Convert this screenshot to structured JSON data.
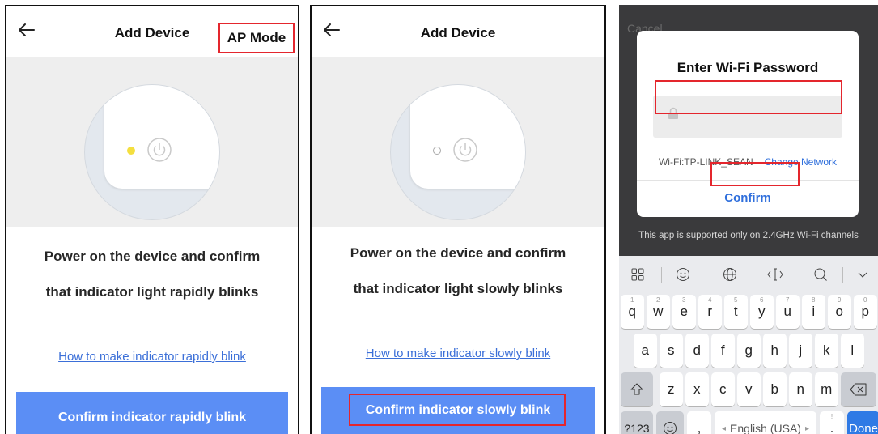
{
  "panel1": {
    "title": "Add Device",
    "ap_mode": "AP Mode",
    "instruction_line1": "Power on the device and confirm",
    "instruction_line2": "that indicator light rapidly blinks",
    "help_link": "How to make indicator rapidly blink",
    "confirm_button": "Confirm indicator rapidly blink"
  },
  "panel2": {
    "title": "Add Device",
    "instruction_line1": "Power on the device and confirm",
    "instruction_line2": "that indicator light slowly blinks",
    "help_link": "How to make indicator slowly blink",
    "confirm_button": "Confirm indicator slowly blink"
  },
  "panel3": {
    "cancel": "Cancel",
    "dialog_title": "Enter Wi-Fi Password",
    "wifi_label": "Wi-Fi:TP-LINK_SEAN",
    "change_network": "Change Network",
    "confirm": "Confirm",
    "note": "This app is supported only on 2.4GHz Wi-Fi channels",
    "keyboard": {
      "row1": [
        {
          "k": "q",
          "n": "1"
        },
        {
          "k": "w",
          "n": "2"
        },
        {
          "k": "e",
          "n": "3"
        },
        {
          "k": "r",
          "n": "4"
        },
        {
          "k": "t",
          "n": "5"
        },
        {
          "k": "y",
          "n": "6"
        },
        {
          "k": "u",
          "n": "7"
        },
        {
          "k": "i",
          "n": "8"
        },
        {
          "k": "o",
          "n": "9"
        },
        {
          "k": "p",
          "n": "0"
        }
      ],
      "row2": [
        "a",
        "s",
        "d",
        "f",
        "g",
        "h",
        "j",
        "k",
        "l"
      ],
      "row3": [
        "z",
        "x",
        "c",
        "v",
        "b",
        "n",
        "m"
      ],
      "mode_key": "?123",
      "comma_key": ",",
      "space_label": "English (USA)",
      "period_key": ".",
      "period_sup": "!",
      "done_key": "Done"
    }
  },
  "colors": {
    "accent_blue": "#5b8ef5",
    "link_blue": "#3b6fd8",
    "highlight_red": "#e4262d",
    "indicator_yellow": "#f4df3f"
  },
  "icons": [
    "back-arrow-icon",
    "power-icon",
    "lock-icon",
    "grid-icon",
    "emoji-icon",
    "globe-icon",
    "cursor-icon",
    "search-icon",
    "chevron-down-icon",
    "shift-icon",
    "backspace-icon"
  ]
}
